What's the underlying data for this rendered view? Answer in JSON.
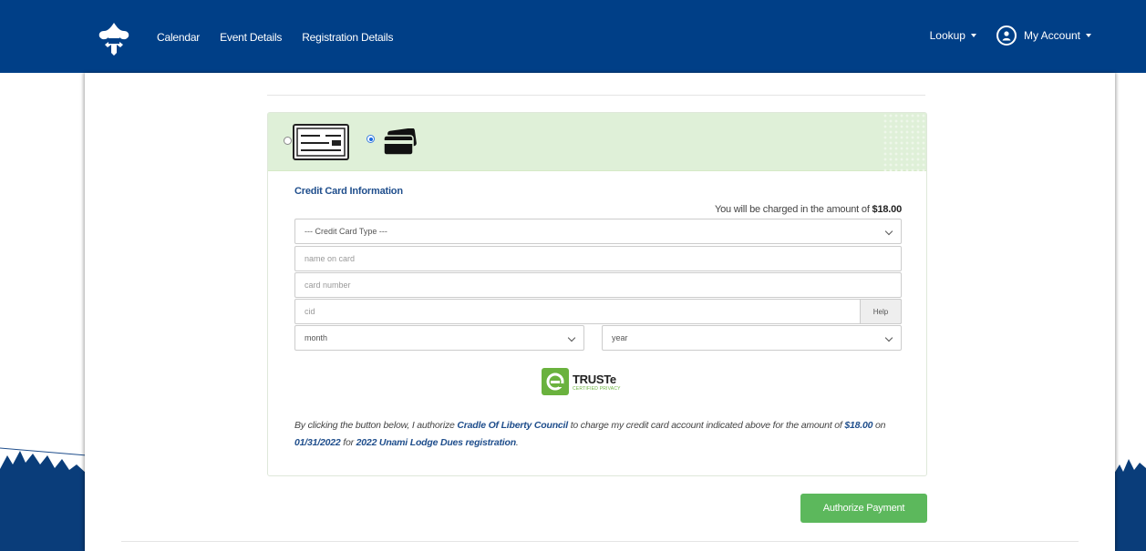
{
  "nav": {
    "logo_icon": "bsa-fleur-de-lis-logo",
    "links": [
      "Calendar",
      "Event Details",
      "Registration Details"
    ],
    "lookup_label": "Lookup",
    "account_label": "My Account"
  },
  "payment": {
    "methods": [
      {
        "icon": "check-icon",
        "selected": false
      },
      {
        "icon": "credit-card-icon",
        "selected": true
      }
    ],
    "section_title": "Credit Card Information",
    "charge_prefix": "You will be charged in the amount of",
    "charge_amount": "$18.00",
    "card_type_value": "--- Credit Card Type ---",
    "name_placeholder": "name on card",
    "number_placeholder": "card number",
    "cvd_placeholder": "cid",
    "help_label": "Help",
    "month_value": "month",
    "year_value": "year",
    "truste_name": "TRUSTe",
    "truste_sub": "CERTIFIED PRIVACY",
    "auth": {
      "part1": "By clicking the button below, I authorize",
      "council": "Cradle Of Liberty Council",
      "part2": "to charge my credit card account indicated above for the amount of",
      "amount": "$18.00",
      "part3": "on",
      "date": "01/31/2022",
      "part4": "for",
      "event": "2022 Unami Lodge Dues registration",
      "part5": "."
    },
    "authorize_button": "Authorize Payment"
  },
  "colors": {
    "navbar": "#003f87",
    "header_bg": "#dff0d8",
    "button": "#5cb85c",
    "link_text": "#1f4e8c"
  }
}
